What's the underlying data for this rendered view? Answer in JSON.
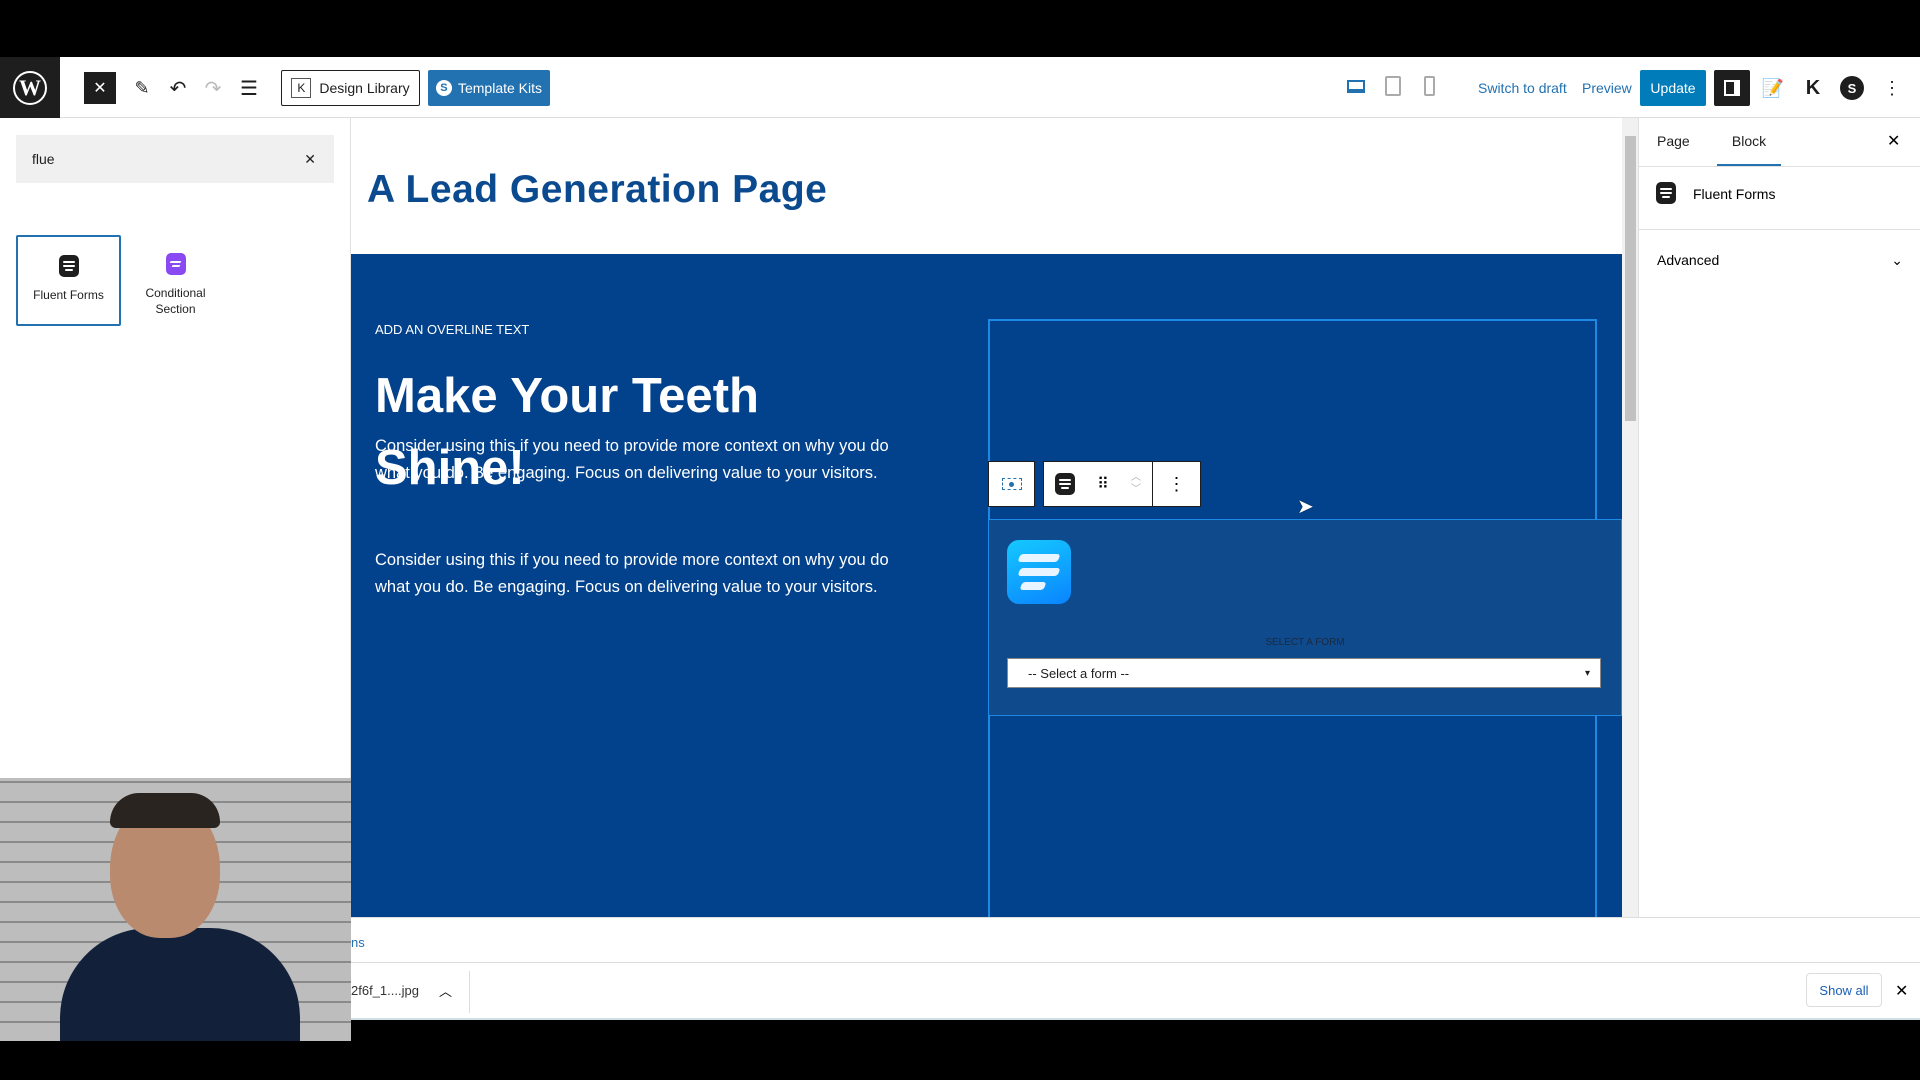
{
  "toolbar": {
    "close_icon": "close-icon",
    "design_library": "Design Library",
    "template_kits": "Template Kits",
    "switch_to_draft": "Switch to draft",
    "preview": "Preview",
    "update": "Update",
    "accent": "#007cba"
  },
  "inserter": {
    "search_value": "flue",
    "results": [
      {
        "label": "Fluent Forms",
        "icon": "fluent-forms-icon"
      },
      {
        "label": "Conditional Section",
        "icon": "conditional-section-icon"
      }
    ]
  },
  "canvas": {
    "page_title": "A Lead Generation Page",
    "overline": "ADD AN OVERLINE TEXT",
    "heading": "Make Your Teeth Shine!",
    "paragraph1": "Consider using this if you need to provide more context on why you do what you do. Be engaging. Focus on delivering value to your visitors.",
    "paragraph2": "Consider using this if you need to provide more context on why you do what you do. Be engaging. Focus on delivering value to your visitors.",
    "select_label": "SELECT A FORM",
    "select_value": "-- Select a form --",
    "hero_color": "#02418b"
  },
  "sidebar": {
    "tabs": [
      "Page",
      "Block"
    ],
    "active_tab": "Block",
    "block_name": "Fluent Forms",
    "advanced": "Advanced"
  },
  "bottom": {
    "link_fragment": "ns",
    "download_file": "2f6f_1....jpg",
    "show_all": "Show all"
  }
}
